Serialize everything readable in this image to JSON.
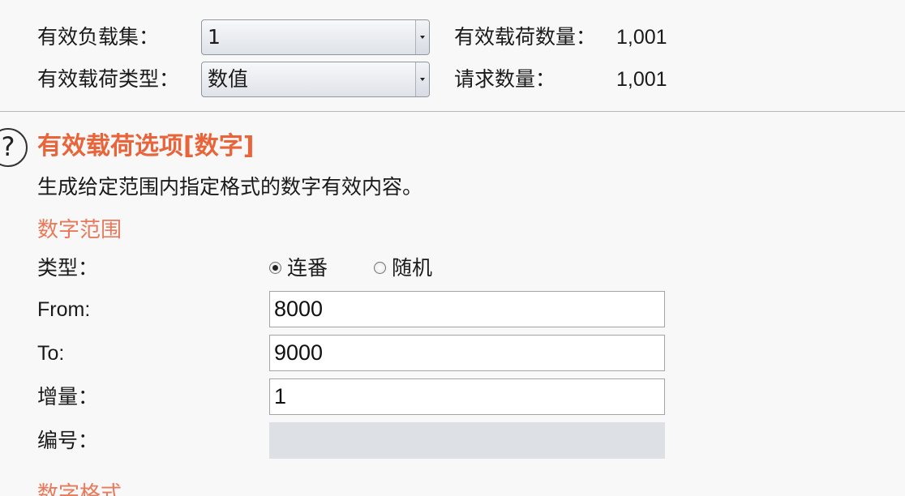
{
  "top": {
    "payload_set_label": "有效负载集：",
    "payload_set_value": "1",
    "payload_count_label": "有效载荷数量：",
    "payload_count_value": "1,001",
    "payload_type_label": "有效载荷类型：",
    "payload_type_value": "数值",
    "request_count_label": "请求数量：",
    "request_count_value": "1,001"
  },
  "options": {
    "help_glyph": "?",
    "title": "有效载荷选项[数字]",
    "description": "生成给定范围内指定格式的数字有效内容。",
    "number_range_heading": "数字范围",
    "type_label": "类型：",
    "type_options": [
      {
        "label": "连番",
        "checked": true
      },
      {
        "label": "随机",
        "checked": false
      }
    ],
    "from_label": "From:",
    "from_value": "8000",
    "to_label": "To:",
    "to_value": "9000",
    "step_label": "增量：",
    "step_value": "1",
    "count_label": "编号：",
    "count_value": "",
    "number_format_heading": "数字格式"
  },
  "colors": {
    "accent": "#e8643a",
    "subheading": "#e8795a",
    "background": "#f8f8f8"
  },
  "icons": {
    "help": "help-icon",
    "dropdown": "chevron-down-icon"
  }
}
